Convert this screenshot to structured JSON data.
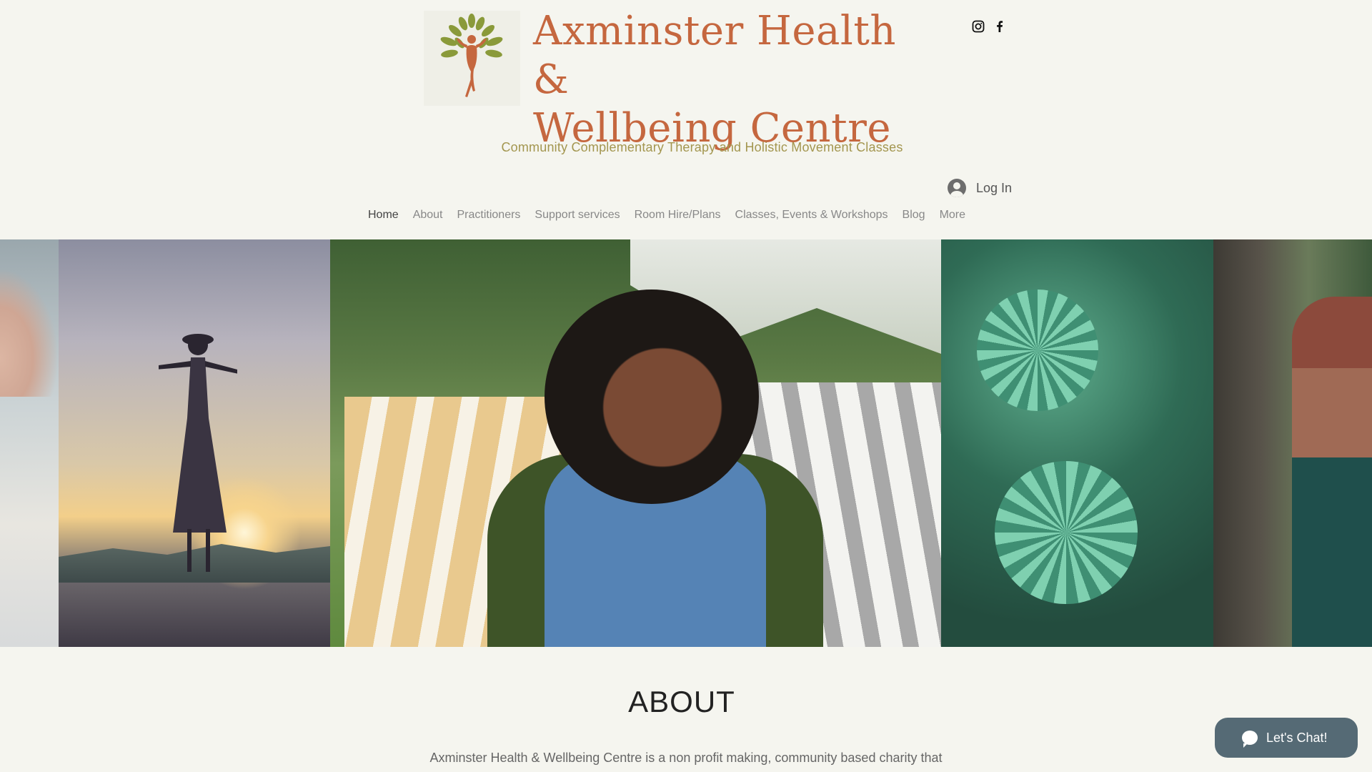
{
  "header": {
    "title_line1": "Axminster Health &",
    "title_line2": "Wellbeing Centre",
    "tagline": "Community Complementary Therapy and Holistic Movement Classes",
    "login_label": "Log In",
    "social": [
      "instagram-icon",
      "facebook-icon"
    ]
  },
  "nav": {
    "items": [
      "Home",
      "About",
      "Practitioners",
      "Support services",
      "Room Hire/Plans",
      "Classes, Events & Workshops",
      "Blog",
      "More"
    ],
    "active": "Home"
  },
  "colors": {
    "background": "#f5f5ef",
    "title": "#c5673f",
    "tagline": "#a3964f",
    "chat": "#556a75"
  },
  "about": {
    "heading": "ABOUT",
    "text": "Axminster Health & Wellbeing Centre is a non profit making, community based charity that"
  },
  "chat": {
    "label": "Let's Chat!"
  }
}
